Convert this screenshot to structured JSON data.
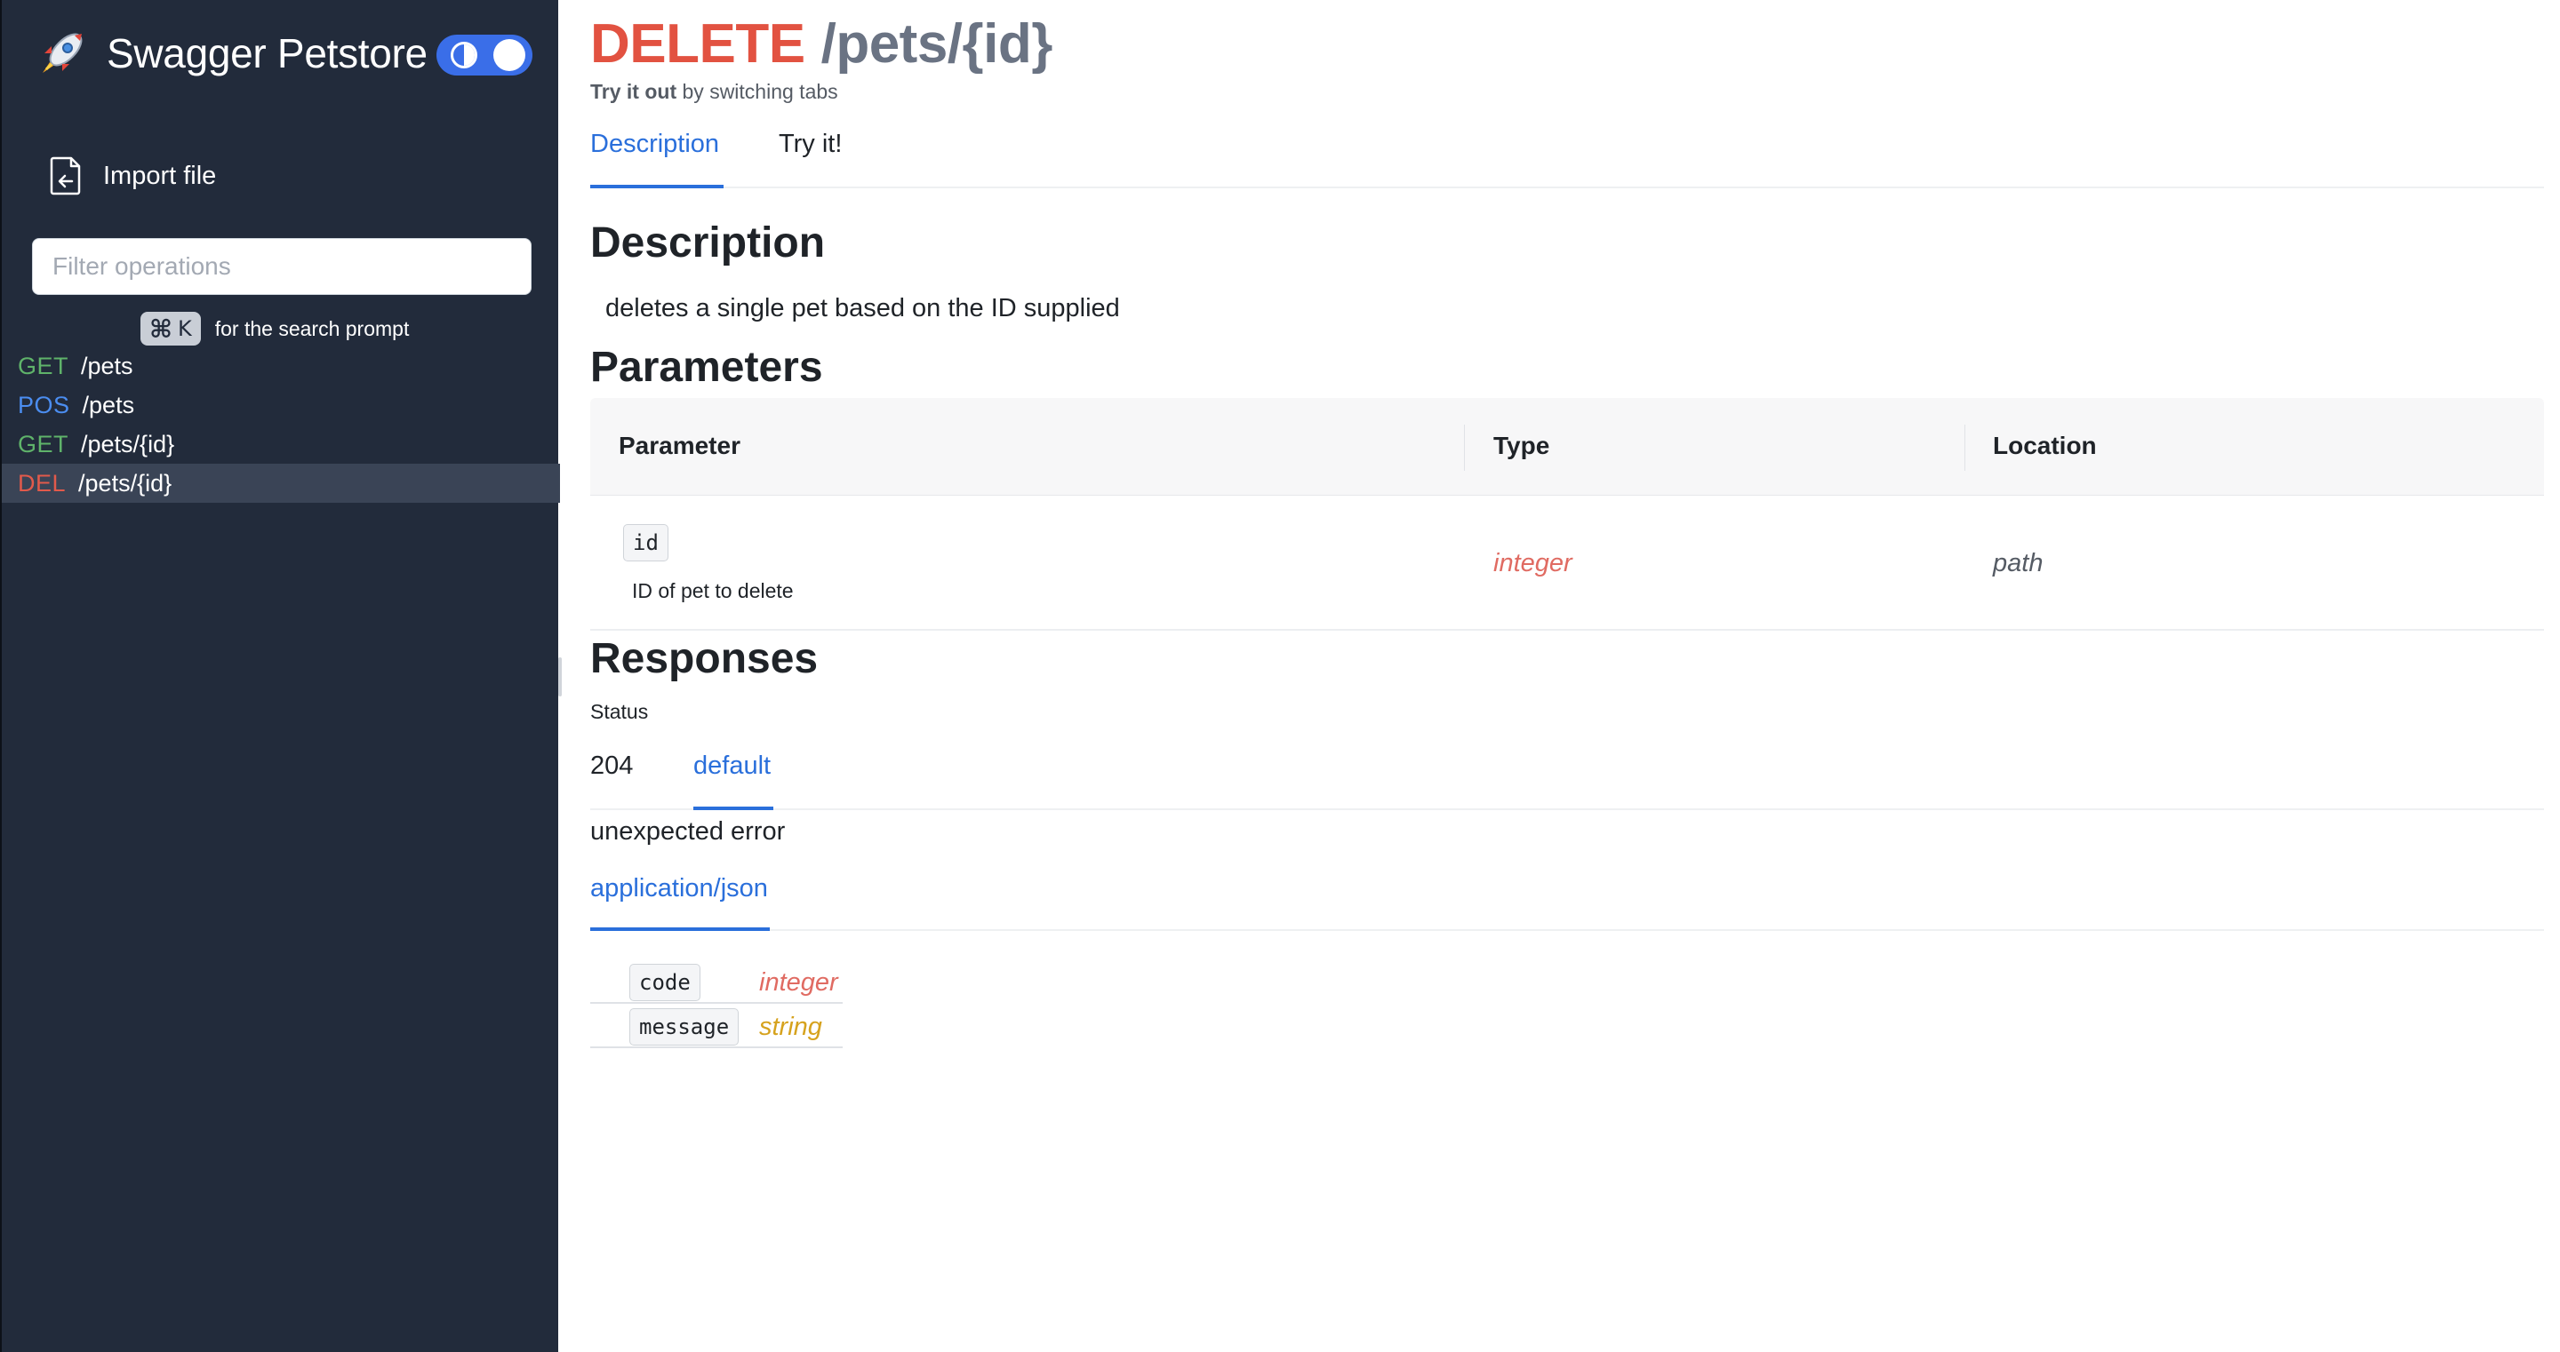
{
  "sidebar": {
    "brand_title": "Swagger Petstore",
    "logo_icon": "rocket-icon",
    "theme_toggle_icon": "contrast-icon",
    "import_label": "Import file",
    "import_icon": "file-import-icon",
    "filter_placeholder": "Filter operations",
    "shortcut_symbol": "⌘",
    "shortcut_key": "K",
    "shortcut_hint": "for the search prompt",
    "operations": [
      {
        "method": "GET",
        "path": "/pets",
        "active": false
      },
      {
        "method": "POS",
        "path": "/pets",
        "active": false
      },
      {
        "method": "GET",
        "path": "/pets/{id}",
        "active": false
      },
      {
        "method": "DEL",
        "path": "/pets/{id}",
        "active": true
      }
    ]
  },
  "operation": {
    "method": "DELETE",
    "path": "/pets/{id}",
    "subtitle_strong": "Try it out",
    "subtitle_rest": "by switching tabs",
    "tabs": [
      "Description",
      "Try it!"
    ],
    "active_tab": "Description"
  },
  "description": {
    "title": "Description",
    "text": "deletes a single pet based on the ID supplied"
  },
  "parameters": {
    "title": "Parameters",
    "columns": [
      "Parameter",
      "Type",
      "Location"
    ],
    "rows": [
      {
        "name": "id",
        "description": "ID of pet to delete",
        "type": "integer",
        "location": "path"
      }
    ]
  },
  "responses": {
    "title": "Responses",
    "status_label": "Status",
    "tabs": [
      "204",
      "default"
    ],
    "active_tab": "default",
    "description": "unexpected error",
    "content_types": [
      "application/json"
    ],
    "schema": [
      {
        "name": "code",
        "type": "integer"
      },
      {
        "name": "message",
        "type": "string"
      }
    ]
  },
  "colors": {
    "sidebar_bg": "#222b3b",
    "accent": "#2a6fdb",
    "delete": "#e25241",
    "get": "#5fb36a",
    "post": "#4b8df0",
    "integer": "#e06b62",
    "string": "#d6a21d"
  }
}
